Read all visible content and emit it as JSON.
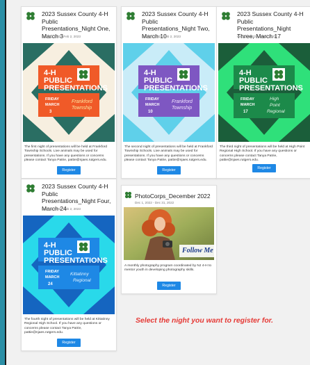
{
  "cards": [
    {
      "title": "2023 Sussex County 4-H Public Presentations_Night One, March 3",
      "date": "Dec 21, 2022 - Feb 2, 2023",
      "poster": {
        "line1": "4-H",
        "line2": "PUBLIC",
        "line3": "PRESENTATIONS",
        "day": "FRIDAY",
        "month": "MARCH",
        "num": "3",
        "loc1": "Frankford",
        "loc2": "Township",
        "colors": {
          "bg": "#f7efe0",
          "accent": "#2a6e63",
          "band": "#f05a28"
        }
      },
      "description": "The first night of presentations will be held at Frankford Township Schools. Live animals may be used for presentations. If you have any questions or concerns please contact Tanya Patrie, pattie@njaes.rutgers.edu.",
      "button": "Register"
    },
    {
      "title": "2023 Sussex County 4-H Public Presentations_Night Two, March 10",
      "date": "Dec 27, 2022 - Feb 2, 2023",
      "poster": {
        "line1": "4-H",
        "line2": "PUBLIC",
        "line3": "PRESENTATIONS",
        "day": "FRIDAY",
        "month": "MARCH",
        "num": "10",
        "loc1": "Frankford",
        "loc2": "Township",
        "colors": {
          "bg": "#c9ecf8",
          "accent": "#5fd0ea",
          "band": "#7e57c2"
        }
      },
      "description": "The second night of presentations will be held at Frankford Township Schools. Live animals may be used for presentations. If you have any questions or concerns please contact Tanya Patrie, pattie@njaes.rutgers.edu.",
      "button": "Register"
    },
    {
      "title": "2023 Sussex County 4-H Public Presentations_Night Three, March 17",
      "date": "Dec 21, 2022 - Feb 2, 2023",
      "poster": {
        "line1": "4-H",
        "line2": "PUBLIC",
        "line3": "PRESENTATIONS",
        "day": "FRIDAY",
        "month": "MARCH",
        "num": "17",
        "loc1": "High",
        "loc2": "Point",
        "loc3": "Regional",
        "colors": {
          "bg": "#2fe07a",
          "accent": "#1b5e3a",
          "band": "#1c8a4a"
        }
      },
      "description": "The third night of presentations will be held at High Point Regional High School. If you have any questions or concerns please contact Tanya Patrie, pattie@njaes.rutgers.edu.",
      "button": "Register"
    },
    {
      "title": "2023 Sussex County 4-H Public Presentations_Night Four, March 24",
      "date": "Dec 15, 2022 - Feb 2, 2023",
      "poster": {
        "line1": "4-H",
        "line2": "PUBLIC",
        "line3": "PRESENTATIONS",
        "day": "FRIDAY",
        "month": "MARCH",
        "num": "24",
        "loc1": "Kittatinny",
        "loc2": "Regional",
        "colors": {
          "bg": "#29d9ea",
          "accent": "#1565c0",
          "band": "#1e88e5"
        }
      },
      "description": "The fourth night of presentations will be held at Kittatinny Regional High School. If you have any questions or concerns please contact Tanya Patrie, pattie@njaes.rutgers.edu.",
      "button": "Register"
    }
  ],
  "photo_card": {
    "title": "PhotoCorps_December 2022",
    "date": "Dec 1, 2022 - Dec 31, 2022",
    "overlay": "Follow Me",
    "description": "A monthly photography program coordinated by NJ 4-H to mentor youth in developing photography skills.",
    "button": "Register"
  },
  "instruction": "Select the night you want to register for.",
  "colors": {
    "page_bg": "#2b8fa6",
    "button": "#1e88e5",
    "instruction": "#e53935",
    "clover": "#2e7d32"
  }
}
